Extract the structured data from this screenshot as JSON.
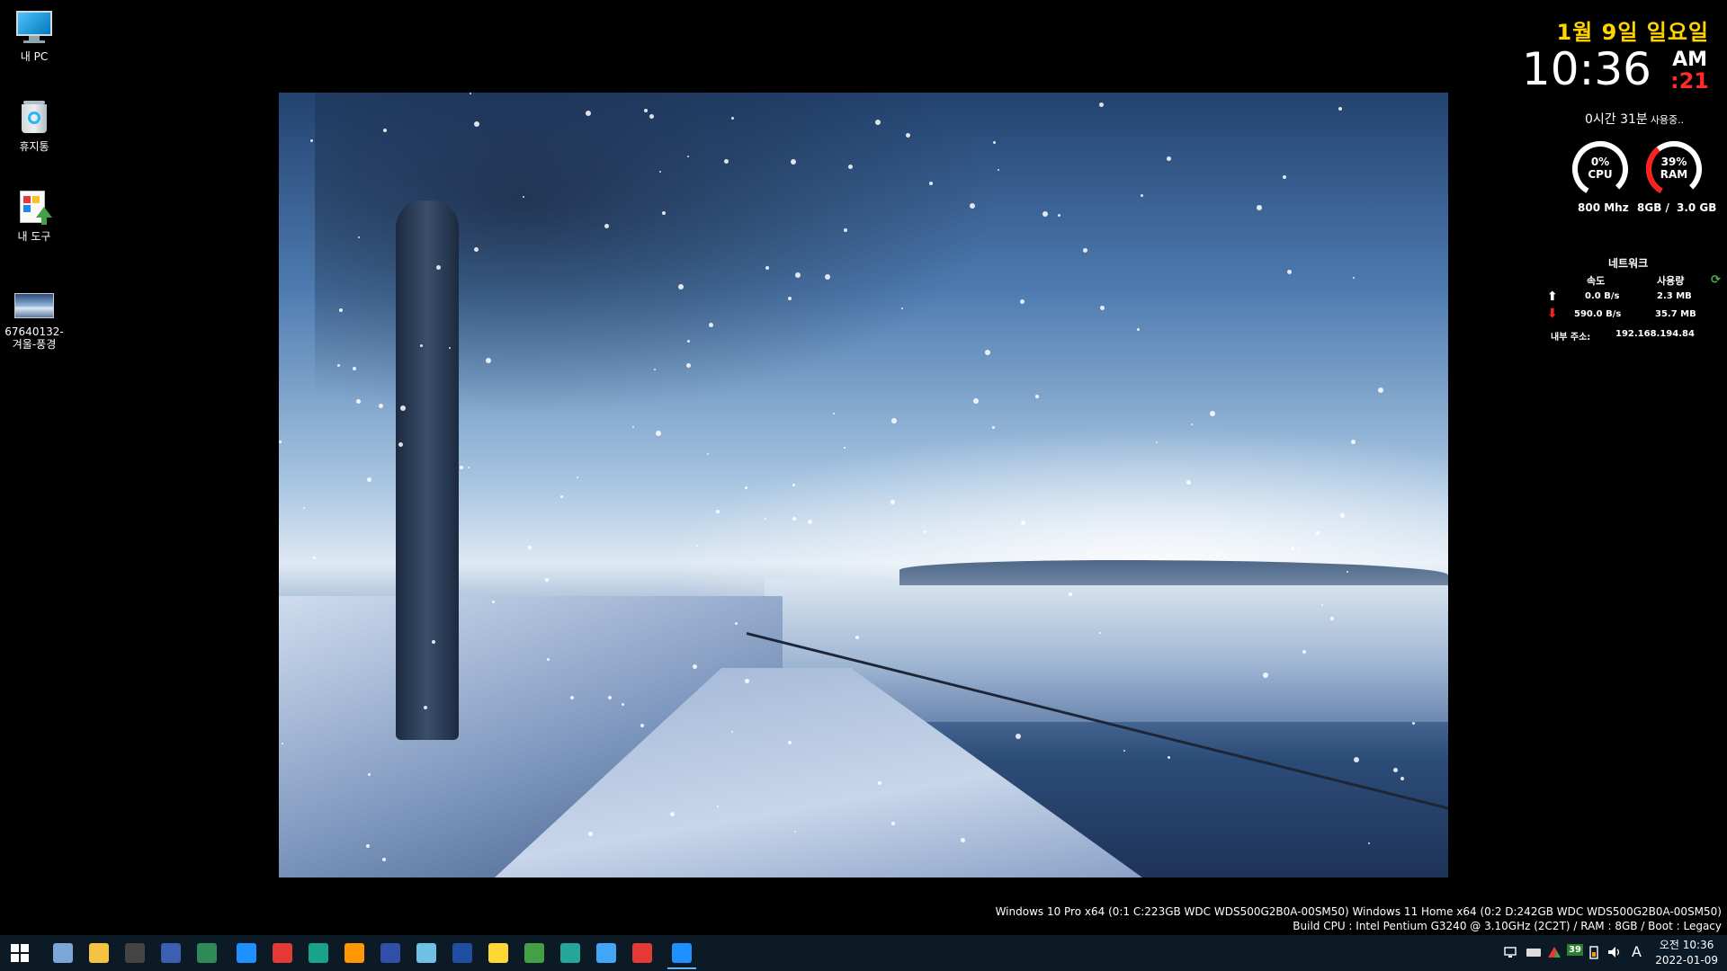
{
  "desktop_icons": [
    {
      "label": "내 PC",
      "icon": "monitor-icon"
    },
    {
      "label": "휴지통",
      "icon": "recycle-bin-icon"
    },
    {
      "label": "내 도구",
      "icon": "tools-icon"
    },
    {
      "label": "67640132-\n겨울-풍경",
      "icon": "image-file-icon"
    }
  ],
  "clock_widget": {
    "date": "1월 9일 일요일",
    "time": "10:36",
    "ampm": "AM",
    "seconds": ":21",
    "uptime": "0시간 31분",
    "uptime_suffix": "사용중.."
  },
  "gauges": {
    "cpu": {
      "percent_label": "0%",
      "name": "CPU",
      "value": 0,
      "sub": "800 Mhz"
    },
    "ram": {
      "percent_label": "39%",
      "name": "RAM",
      "value": 39,
      "sub_total": "8GB /",
      "sub_used": "3.0 GB"
    }
  },
  "network": {
    "title": "네트워크",
    "col_speed": "속도",
    "col_usage": "사용량",
    "up_speed": "0.0 B/s",
    "up_usage": "2.3 MB",
    "down_speed": "590.0 B/s",
    "down_usage": "35.7 MB",
    "ip_label": "내부 주소:",
    "ip_value": "192.168.194.84"
  },
  "os_info": {
    "line1": "Windows 10 Pro x64 (0:1 C:223GB WDC  WDS500G2B0A-00SM50) Windows 11 Home x64 (0:2 D:242GB WDC  WDS500G2B0A-00SM50)",
    "line2": "Build CPU : Intel Pentium G3240 @ 3.10GHz (2C2T) / RAM : 8GB / Boot : Legacy"
  },
  "taskbar": {
    "apps": [
      {
        "name": "start-button",
        "color": "#ffffff"
      },
      {
        "name": "search-icon",
        "color": "#7aa7d6"
      },
      {
        "name": "file-explorer-icon",
        "color": "#f5c242"
      },
      {
        "name": "command-prompt-icon",
        "color": "#444444"
      },
      {
        "name": "save-disk-icon",
        "color": "#3b5fb3"
      },
      {
        "name": "network-card-icon",
        "color": "#2e8b57"
      },
      {
        "name": "internet-explorer-icon",
        "color": "#1e90ff"
      },
      {
        "name": "chrome-icon",
        "color": "#e53935"
      },
      {
        "name": "edge-icon",
        "color": "#1aa38c"
      },
      {
        "name": "media-player-icon",
        "color": "#ff9800"
      },
      {
        "name": "recovery-tool-icon",
        "color": "#2f4fa8"
      },
      {
        "name": "notepad-icon",
        "color": "#6ec1e4"
      },
      {
        "name": "grid-tool-icon",
        "color": "#1f4ea3"
      },
      {
        "name": "sticky-note-icon",
        "color": "#fdd835"
      },
      {
        "name": "installer-icon",
        "color": "#43a047"
      },
      {
        "name": "remote-desktop-icon",
        "color": "#26a69a"
      },
      {
        "name": "folder-tool-icon",
        "color": "#42a5f5"
      },
      {
        "name": "power-icon",
        "color": "#e53935"
      },
      {
        "name": "internet-explorer-icon",
        "color": "#1e90ff"
      }
    ],
    "tray_battery_value": "39",
    "tray_ime": "A",
    "tray_time": "오전 10:36",
    "tray_date": "2022-01-09"
  }
}
